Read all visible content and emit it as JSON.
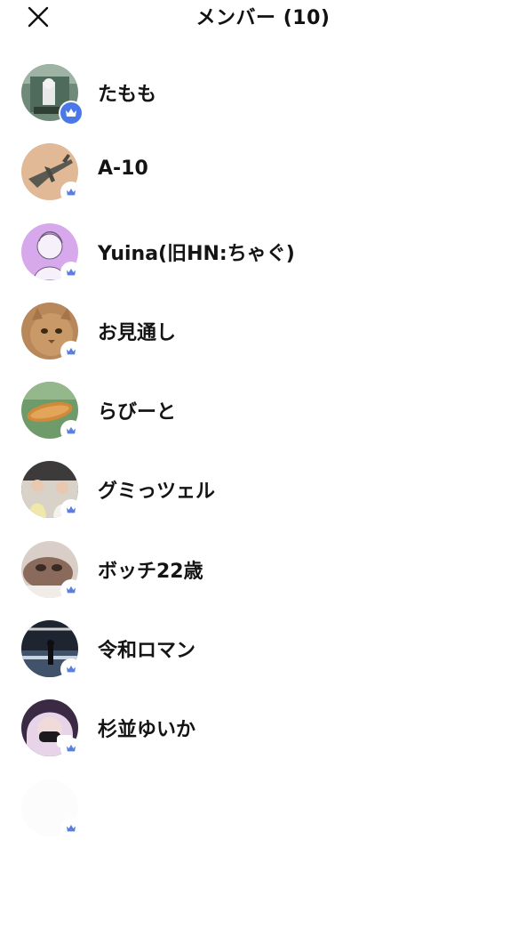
{
  "header": {
    "title": "メンバー (10)",
    "close_icon": "close-icon"
  },
  "colors": {
    "crown_owner_bg": "#4b78e8",
    "crown": "#5b7fe0",
    "text": "#141414",
    "background": "#ffffff"
  },
  "members": [
    {
      "name": "たもも",
      "role_icon": "crown-icon",
      "owner": true
    },
    {
      "name": "A-10",
      "role_icon": "crown-icon",
      "owner": false
    },
    {
      "name": "Yuina(旧HN:ちゃぐ)",
      "role_icon": "crown-icon",
      "owner": false
    },
    {
      "name": "お見通し",
      "role_icon": "crown-icon",
      "owner": false
    },
    {
      "name": "らびーと",
      "role_icon": "crown-icon",
      "owner": false
    },
    {
      "name": "グミっツェル",
      "role_icon": "crown-icon",
      "owner": false
    },
    {
      "name": "ボッチ22歳",
      "role_icon": "crown-icon",
      "owner": false
    },
    {
      "name": "令和ロマン",
      "role_icon": "crown-icon",
      "owner": false
    },
    {
      "name": "杉並ゆいか",
      "role_icon": "crown-icon",
      "owner": false
    },
    {
      "name": "",
      "role_icon": "crown-icon",
      "owner": false
    }
  ]
}
